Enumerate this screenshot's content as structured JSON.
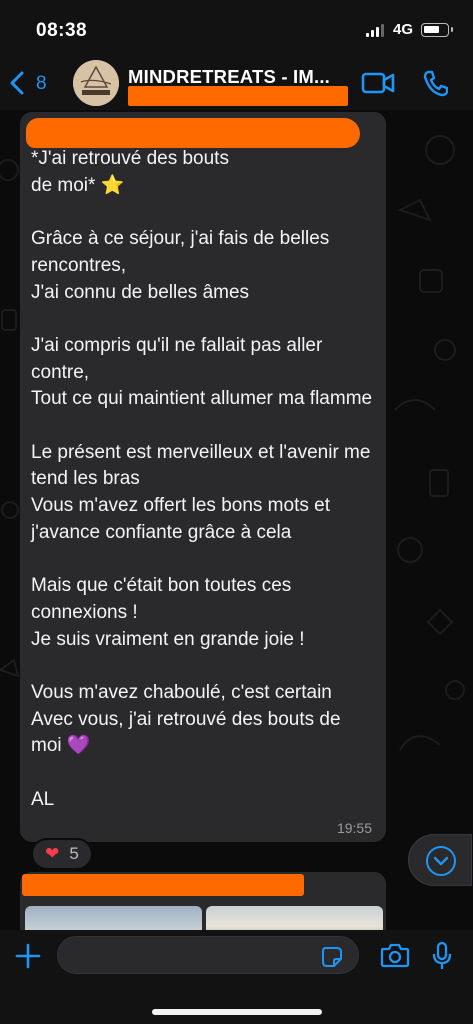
{
  "status_bar": {
    "time": "08:38",
    "network": "4G"
  },
  "header": {
    "back_count": "8",
    "title": "MINDRETREATS - IM...",
    "accent_color": "#1f96f5",
    "redaction_color": "#ff6a00"
  },
  "messages": [
    {
      "text": "*J'ai retrouvé des bouts\nde moi* ⭐\n\nGrâce à ce séjour, j'ai fais de belles rencontres,\nJ'ai connu de belles âmes\n\nJ'ai compris qu'il ne fallait pas aller contre,\nTout ce qui maintient allumer ma flamme\n\nLe présent est merveilleux et l'avenir me tend les bras\nVous m'avez offert les bons mots et j'avance confiante grâce à cela\n\nMais que c'était bon toutes ces connexions !\nJe suis vraiment en grande joie !\n\nVous m'avez chaboulé, c'est certain\nAvec vous, j'ai retrouvé des bouts de moi 💜\n\nAL",
      "time": "19:55",
      "reaction": {
        "emoji": "❤",
        "count": "5"
      }
    }
  ],
  "input": {
    "placeholder": ""
  },
  "icons": [
    "back-chevron-icon",
    "video-call-icon",
    "phone-icon",
    "chevron-down-icon",
    "plus-icon",
    "sticker-icon",
    "camera-icon",
    "microphone-icon"
  ]
}
